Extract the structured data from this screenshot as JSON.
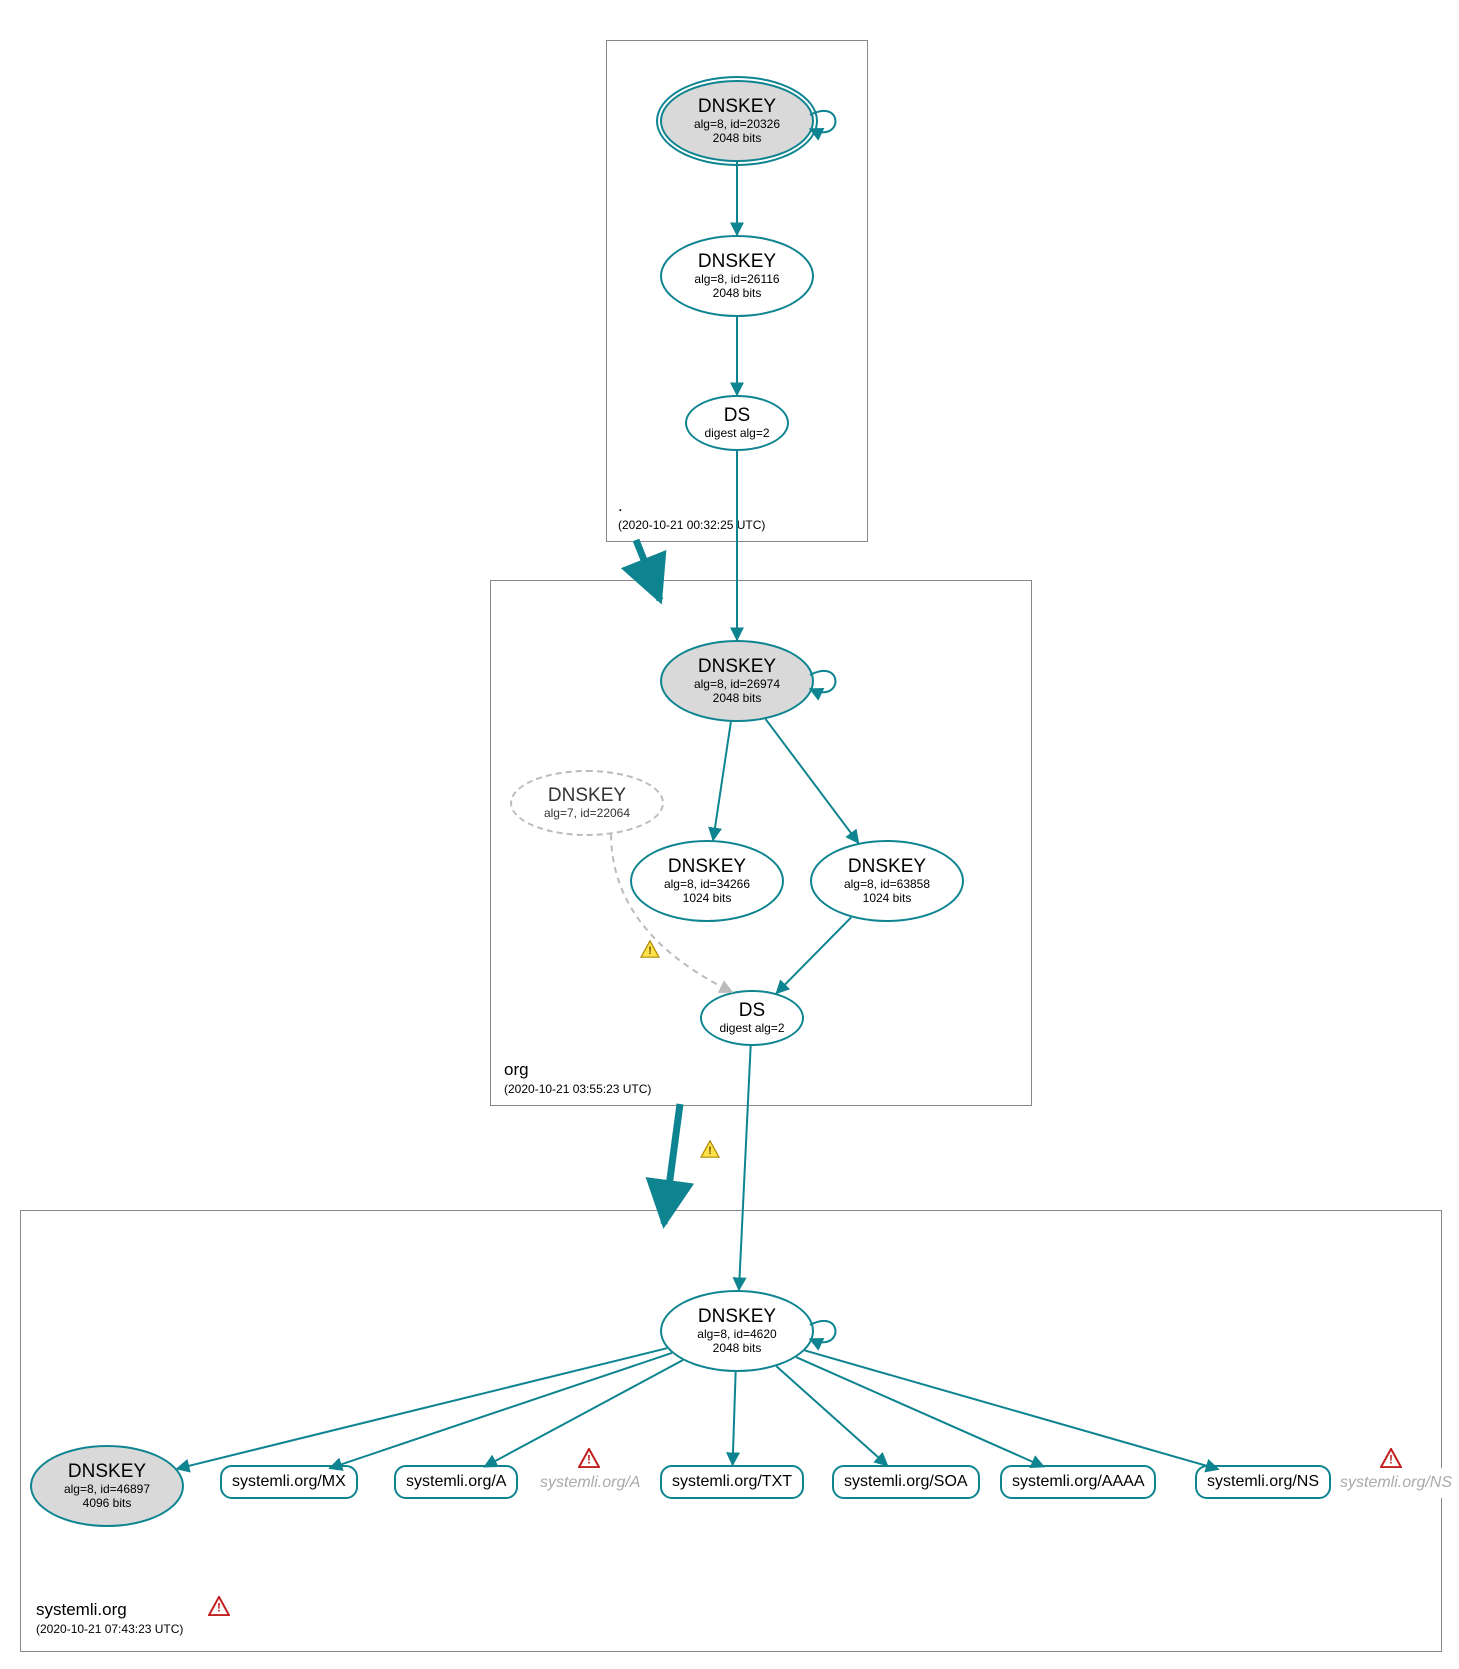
{
  "zones": {
    "root": {
      "label": ".",
      "timestamp": "(2020-10-21 00:32:25 UTC)",
      "nodes": {
        "ksk": {
          "title": "DNSKEY",
          "sub1": "alg=8, id=20326",
          "sub2": "2048 bits"
        },
        "zsk": {
          "title": "DNSKEY",
          "sub1": "alg=8, id=26116",
          "sub2": "2048 bits"
        },
        "ds": {
          "title": "DS",
          "sub1": "digest alg=2"
        }
      }
    },
    "org": {
      "label": "org",
      "timestamp": "(2020-10-21 03:55:23 UTC)",
      "nodes": {
        "ksk": {
          "title": "DNSKEY",
          "sub1": "alg=8, id=26974",
          "sub2": "2048 bits"
        },
        "revoked": {
          "title": "DNSKEY",
          "sub1": "alg=7, id=22064"
        },
        "zsk1": {
          "title": "DNSKEY",
          "sub1": "alg=8, id=34266",
          "sub2": "1024 bits"
        },
        "zsk2": {
          "title": "DNSKEY",
          "sub1": "alg=8, id=63858",
          "sub2": "1024 bits"
        },
        "ds": {
          "title": "DS",
          "sub1": "digest alg=2"
        }
      }
    },
    "systemli": {
      "label": "systemli.org",
      "timestamp": "(2020-10-21 07:43:23 UTC)",
      "nodes": {
        "zsk": {
          "title": "DNSKEY",
          "sub1": "alg=8, id=4620",
          "sub2": "2048 bits"
        },
        "ksk": {
          "title": "DNSKEY",
          "sub1": "alg=8, id=46897",
          "sub2": "4096 bits"
        }
      },
      "records": {
        "mx": "systemli.org/MX",
        "a": "systemli.org/A",
        "a_err": "systemli.org/A",
        "txt": "systemli.org/TXT",
        "soa": "systemli.org/SOA",
        "aaaa": "systemli.org/AAAA",
        "ns": "systemli.org/NS",
        "ns_err": "systemli.org/NS"
      }
    }
  }
}
